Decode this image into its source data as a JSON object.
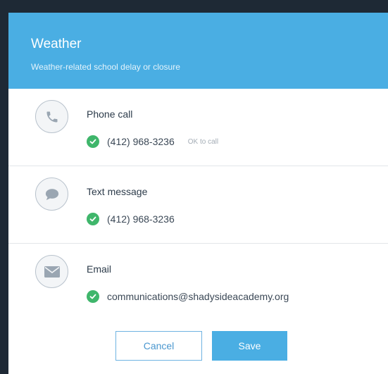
{
  "modal": {
    "title": "Weather",
    "subtitle": "Weather-related school delay or closure"
  },
  "methods": [
    {
      "title": "Phone call",
      "icon": "phone-icon",
      "value": "(412) 968-3236",
      "note": "OK to call"
    },
    {
      "title": "Text message",
      "icon": "speech-bubble-icon",
      "value": "(412) 968-3236",
      "note": ""
    },
    {
      "title": "Email",
      "icon": "envelope-icon",
      "value": "communications@shadysideacademy.org",
      "note": ""
    }
  ],
  "footer": {
    "cancel_label": "Cancel",
    "save_label": "Save"
  },
  "colors": {
    "header": "#4aaee3",
    "check": "#3fb66b",
    "icon": "#9aa6b2"
  }
}
